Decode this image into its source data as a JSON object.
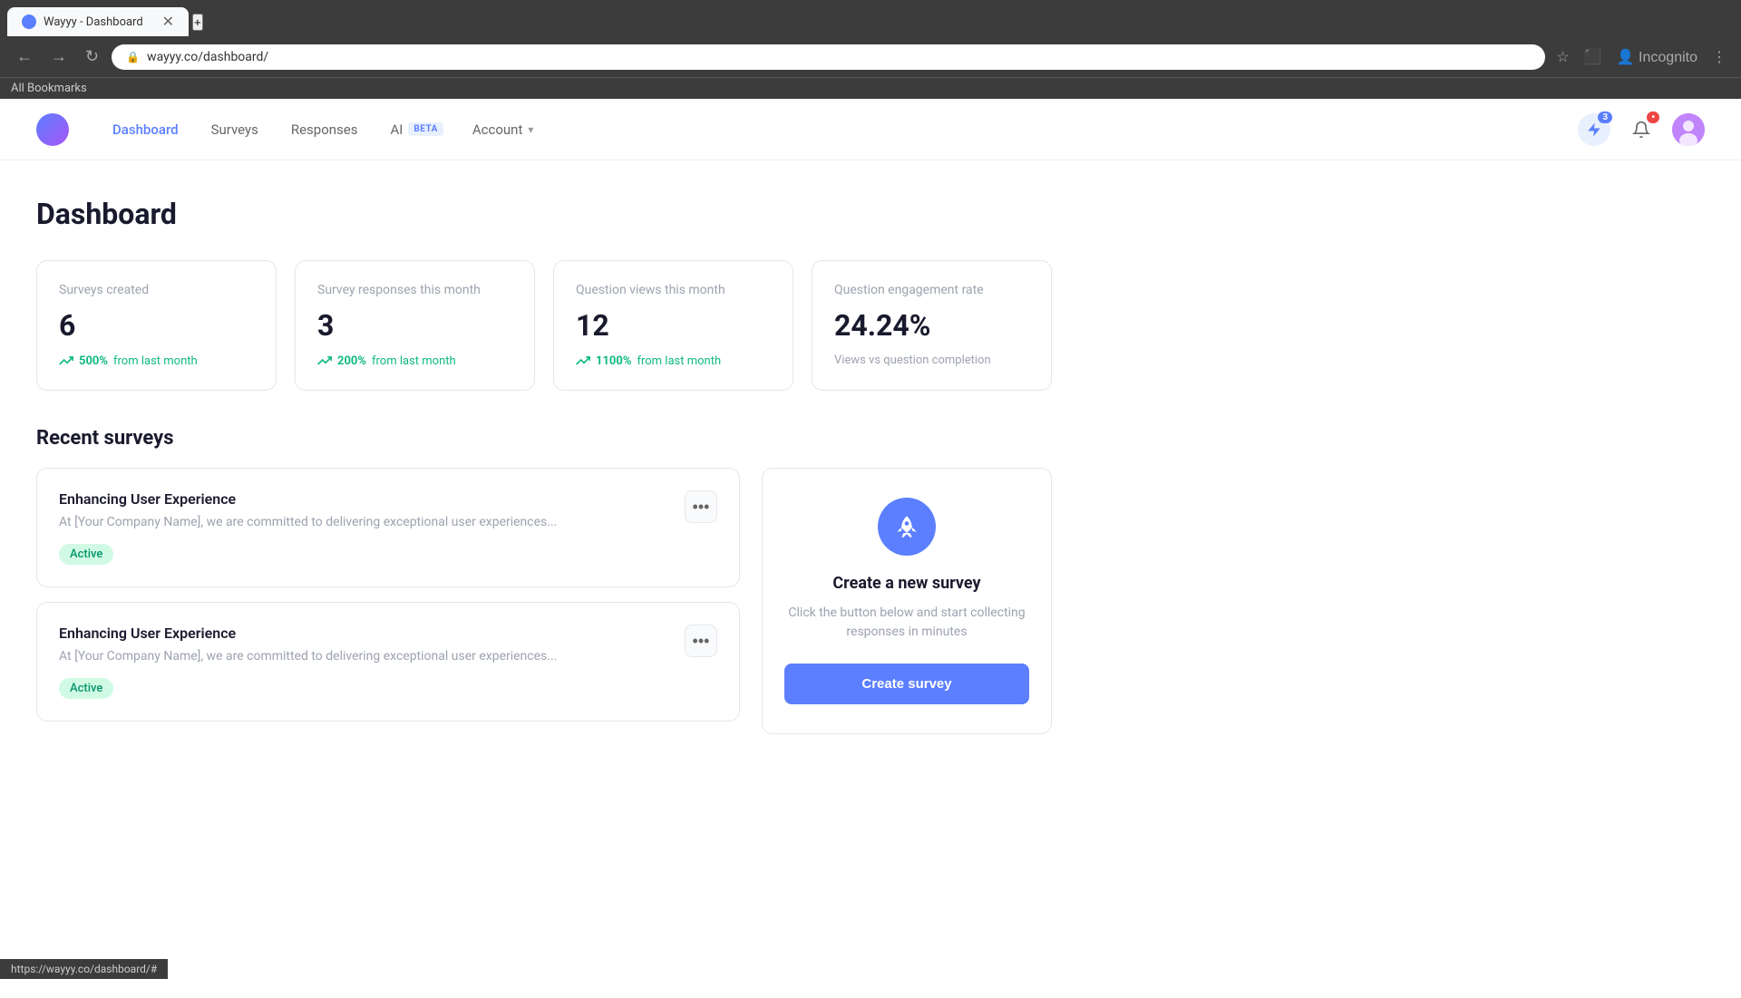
{
  "browser": {
    "tab_title": "Wayyy - Dashboard",
    "url": "wayyy.co/dashboard/",
    "bookmarks_label": "All Bookmarks",
    "status_bar_url": "https://wayyy.co/dashboard/#"
  },
  "navbar": {
    "dashboard_label": "Dashboard",
    "surveys_label": "Surveys",
    "responses_label": "Responses",
    "ai_label": "AI",
    "ai_badge": "BETA",
    "account_label": "Account",
    "notification_count": "3"
  },
  "page": {
    "title": "Dashboard"
  },
  "stats": [
    {
      "label": "Surveys created",
      "value": "6",
      "change": "500%",
      "change_text": "from last month"
    },
    {
      "label": "Survey responses this month",
      "value": "3",
      "change": "200%",
      "change_text": "from last month"
    },
    {
      "label": "Question views this month",
      "value": "12",
      "change": "1100%",
      "change_text": "from last month"
    },
    {
      "label": "Question engagement rate",
      "value": "24.24%",
      "note": "Views vs question completion"
    }
  ],
  "recent_surveys": {
    "section_title": "Recent surveys",
    "surveys": [
      {
        "name": "Enhancing User Experience",
        "description": "At [Your Company Name], we are committed to delivering exceptional user experiences...",
        "status": "Active"
      },
      {
        "name": "Enhancing User Experience",
        "description": "At [Your Company Name], we are committed to delivering exceptional user experiences...",
        "status": "Active"
      }
    ]
  },
  "create_panel": {
    "title": "Create a new survey",
    "description": "Click the button below and start collecting responses in minutes",
    "button_label": "Create survey"
  }
}
